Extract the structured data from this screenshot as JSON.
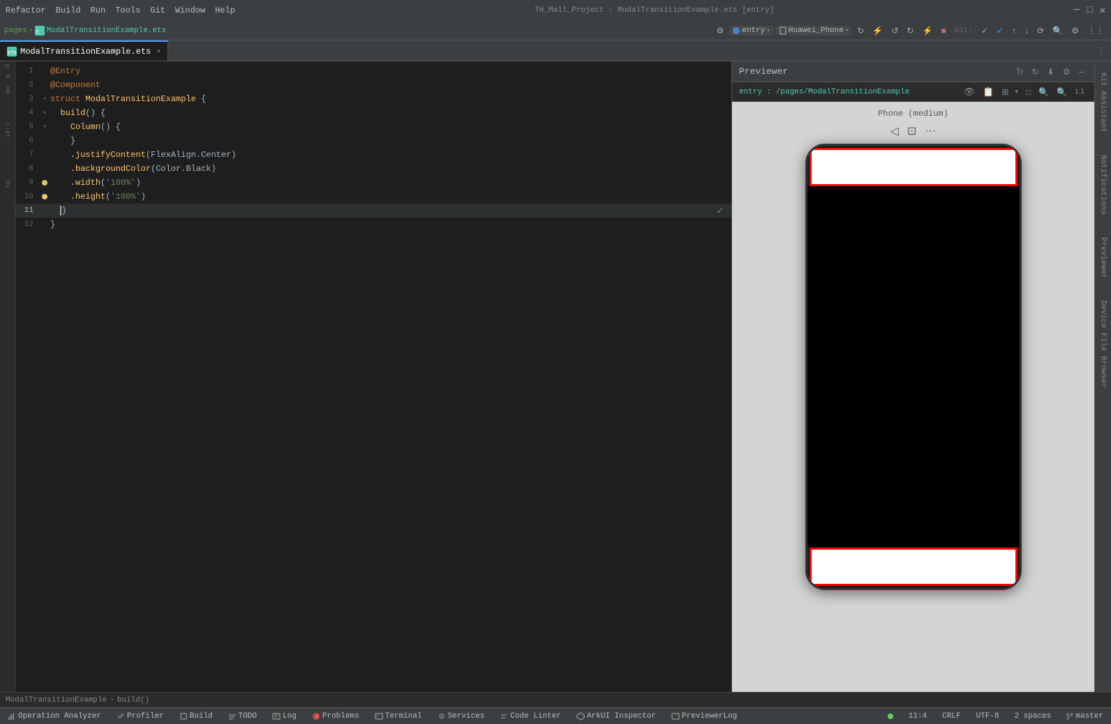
{
  "titleBar": {
    "menus": [
      "Refactor",
      "Build",
      "Run",
      "Tools",
      "Git",
      "Window",
      "Help"
    ],
    "title": "TH_Mall_Project - ModalTransitionExample.ets [entry]",
    "controls": [
      "─",
      "□",
      "✕"
    ]
  },
  "toolbar2": {
    "breadcrumb": "pages",
    "file": "ModalTransitionExample.ets",
    "buttons": [
      "⚙",
      "entry ▾",
      "Huawei_Phone ▾"
    ],
    "rightButtons": [
      "↻",
      "⚡",
      "↺",
      "↻",
      "⚡",
      "■"
    ]
  },
  "tabs": {
    "active": "ModalTransitionExample.ets",
    "items": [
      {
        "label": "ModalTransitionExample.ets",
        "icon": "ets",
        "active": true
      }
    ]
  },
  "editor": {
    "lines": [
      {
        "num": 1,
        "gutter": "",
        "text": "@Entry",
        "classes": "kw-decorator"
      },
      {
        "num": 2,
        "gutter": "",
        "text": "@Component",
        "classes": "kw-decorator"
      },
      {
        "num": 3,
        "gutter": "fold",
        "text": "struct ModalTransitionExample {",
        "parts": [
          {
            "text": "struct ",
            "cls": "kw-struct"
          },
          {
            "text": "ModalTransitionExample ",
            "cls": "class-name"
          },
          {
            "text": "{",
            "cls": "bracket"
          }
        ]
      },
      {
        "num": 4,
        "gutter": "fold",
        "text": "  build() {",
        "parts": [
          {
            "text": "  "
          },
          {
            "text": "build",
            "cls": "kw-method"
          },
          {
            "text": "() {",
            "cls": "punctuation"
          }
        ]
      },
      {
        "num": 5,
        "gutter": "fold",
        "text": "    Column() {",
        "parts": [
          {
            "text": "    "
          },
          {
            "text": "Column",
            "cls": "method-call"
          },
          {
            "text": "() {",
            "cls": "punctuation"
          }
        ]
      },
      {
        "num": 6,
        "gutter": "",
        "text": "    }",
        "parts": [
          {
            "text": "    "
          },
          {
            "text": "}",
            "cls": "punctuation"
          }
        ]
      },
      {
        "num": 7,
        "gutter": "",
        "text": "    .justifyContent(FlexAlign.Center)",
        "parts": [
          {
            "text": "    "
          },
          {
            "text": ".justifyContent",
            "cls": "method-call"
          },
          {
            "text": "(FlexAlign.Center)",
            "cls": "punctuation"
          }
        ]
      },
      {
        "num": 8,
        "gutter": "",
        "text": "    .backgroundColor(Color.Black)",
        "parts": [
          {
            "text": "    "
          },
          {
            "text": ".backgroundColor",
            "cls": "method-call"
          },
          {
            "text": "(Color.Black)",
            "cls": "punctuation"
          }
        ]
      },
      {
        "num": 9,
        "gutter": "warning",
        "text": "    .width('100%')",
        "parts": [
          {
            "text": "    "
          },
          {
            "text": ".width",
            "cls": "method-call"
          },
          {
            "text": "(",
            "cls": "punctuation"
          },
          {
            "text": "'100%'",
            "cls": "str-val"
          },
          {
            "text": ")",
            "cls": "punctuation"
          }
        ]
      },
      {
        "num": 10,
        "gutter": "warning",
        "text": "    .height('100%')",
        "parts": [
          {
            "text": "    "
          },
          {
            "text": ".height",
            "cls": "method-call"
          },
          {
            "text": "(",
            "cls": "punctuation"
          },
          {
            "text": "'100%'",
            "cls": "str-val"
          },
          {
            "text": ")",
            "cls": "punctuation"
          }
        ]
      },
      {
        "num": 11,
        "gutter": "",
        "text": "  }",
        "highlight": true,
        "parts": [
          {
            "text": "  "
          },
          {
            "text": "}",
            "cls": "punctuation"
          }
        ]
      },
      {
        "num": 12,
        "gutter": "",
        "text": "}",
        "parts": [
          {
            "text": "}",
            "cls": "punctuation"
          }
        ]
      }
    ]
  },
  "previewer": {
    "title": "Previewer",
    "path": "entry : /pages/ModalTransitionExample",
    "deviceLabel": "Phone (medium)",
    "navButtons": [
      "◁",
      "⊡",
      "···"
    ],
    "toolButtons": [
      "👁",
      "📋",
      "⊞ ▾",
      "□",
      "🔍",
      "🔍",
      "1:1"
    ]
  },
  "breadcrumb": {
    "items": [
      "ModalTransitionExample",
      "build()"
    ]
  },
  "statusBar": {
    "items": [
      {
        "label": "Operation Analyzer",
        "icon": "chart"
      },
      {
        "label": "Profiler",
        "icon": "profiler"
      },
      {
        "label": "Build",
        "icon": "build"
      },
      {
        "label": "TODO",
        "icon": "todo"
      },
      {
        "label": "Log",
        "icon": "log"
      },
      {
        "label": "Problems",
        "icon": "problems",
        "badge": "!"
      },
      {
        "label": "Terminal",
        "icon": "terminal"
      },
      {
        "label": "Services",
        "icon": "services"
      },
      {
        "label": "Code Linter",
        "icon": "linter"
      },
      {
        "label": "ArkUI Inspector",
        "icon": "arkui"
      },
      {
        "label": "PreviewerLog",
        "icon": "log2"
      }
    ],
    "right": {
      "greenDot": true,
      "position": "11:4",
      "lineEnding": "CRLF",
      "encoding": "UTF-8",
      "indent": "2 spaces",
      "branch": "master"
    }
  },
  "rightTabs": [
    "Kit Assistant",
    "Notifications",
    "Previewer",
    "Device File Browser"
  ]
}
